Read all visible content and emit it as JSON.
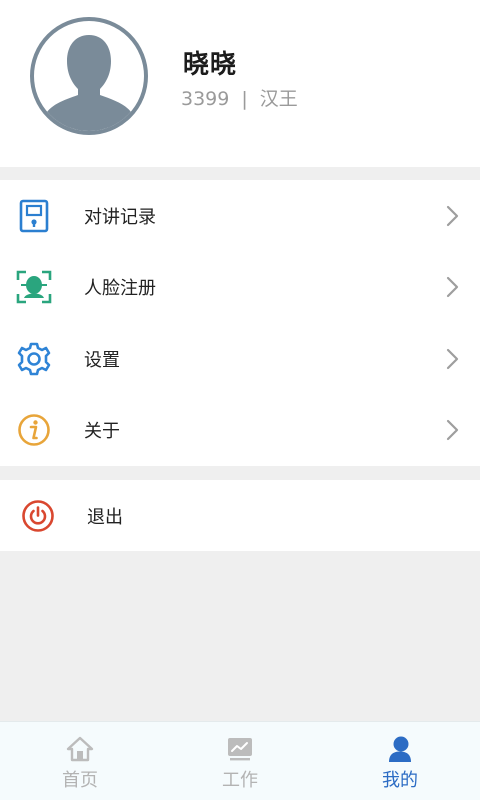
{
  "profile": {
    "name": "晓晓",
    "account": "3399",
    "separator": "|",
    "org": "汉王"
  },
  "menu": {
    "items": [
      {
        "label": "对讲记录",
        "icon": "intercom-record-icon",
        "color": "#2b7fd0"
      },
      {
        "label": "人脸注册",
        "icon": "face-register-icon",
        "color": "#2aa57e"
      },
      {
        "label": "设置",
        "icon": "gear-icon",
        "color": "#2f84d6"
      },
      {
        "label": "关于",
        "icon": "info-icon",
        "color": "#e8a53a"
      }
    ],
    "logout": {
      "label": "退出",
      "icon": "power-icon",
      "color": "#d9472f"
    }
  },
  "tabbar": {
    "tabs": [
      {
        "label": "首页",
        "icon": "home-icon",
        "active": false
      },
      {
        "label": "工作",
        "icon": "chart-icon",
        "active": false
      },
      {
        "label": "我的",
        "icon": "user-icon",
        "active": true
      }
    ],
    "active_color": "#2c6cc4",
    "inactive_color": "#b3b3b3"
  }
}
